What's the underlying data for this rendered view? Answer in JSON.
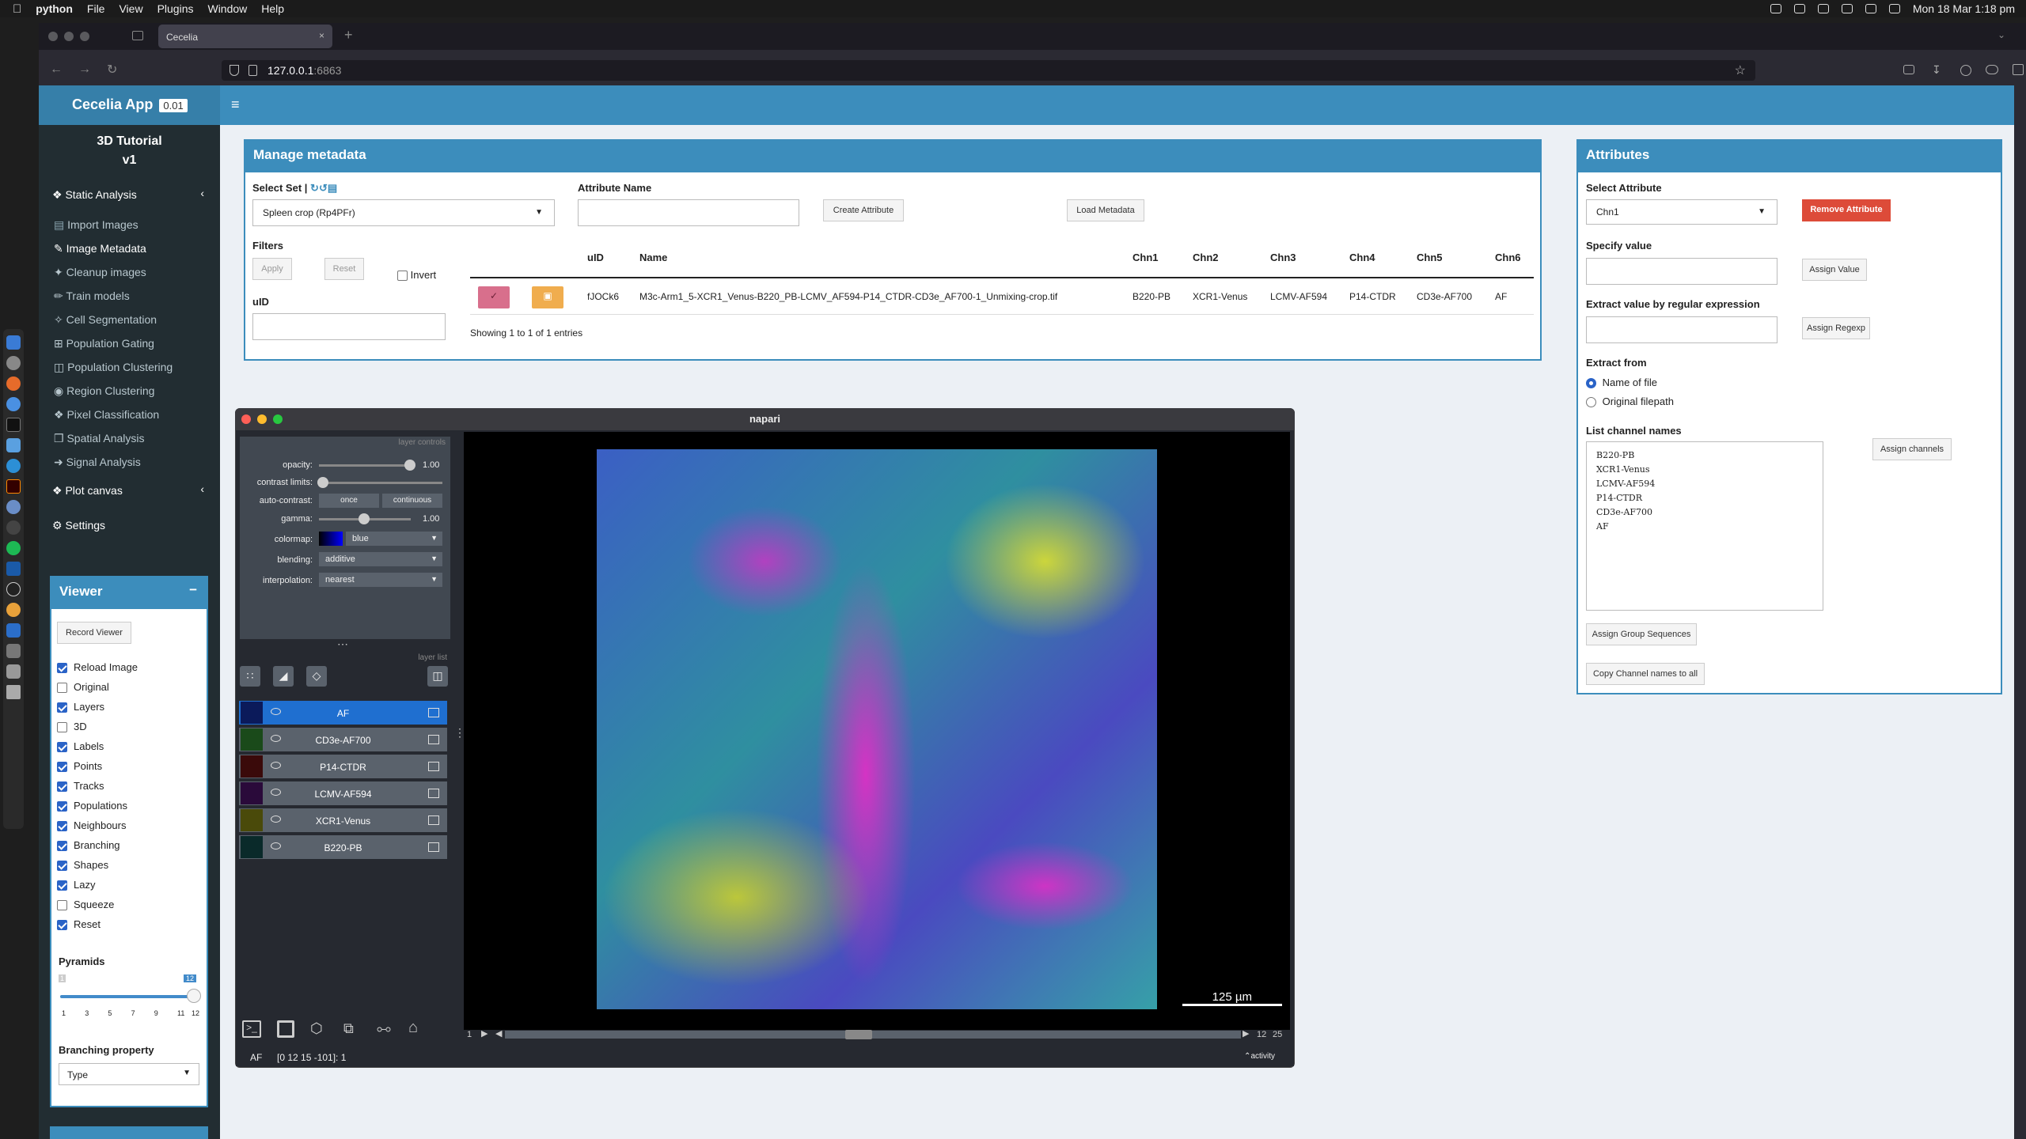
{
  "menubar": {
    "app": "python",
    "items": [
      "File",
      "View",
      "Plugins",
      "Window",
      "Help"
    ],
    "clock": "Mon 18 Mar  1:18 pm"
  },
  "browser": {
    "tab_title": "Cecelia",
    "url_host": "127.0.0.1",
    "url_port": ":6863"
  },
  "app": {
    "brand": "Cecelia App",
    "version": "0.01",
    "project_title": "3D Tutorial",
    "project_version": "v1",
    "sidebar": {
      "static_analysis": "Static Analysis",
      "items": [
        "Import Images",
        "Image Metadata",
        "Cleanup images",
        "Train models",
        "Cell Segmentation",
        "Population Gating",
        "Population Clustering",
        "Region Clustering",
        "Pixel Classification",
        "Spatial Analysis",
        "Signal Analysis"
      ],
      "plot_canvas": "Plot canvas",
      "settings": "Settings"
    },
    "viewer": {
      "title": "Viewer",
      "collapse": "−",
      "record_button": "Record Viewer",
      "options": [
        {
          "label": "Reload Image",
          "checked": true
        },
        {
          "label": "Original",
          "checked": false
        },
        {
          "label": "Layers",
          "checked": true
        },
        {
          "label": "3D",
          "checked": false
        },
        {
          "label": "Labels",
          "checked": true
        },
        {
          "label": "Points",
          "checked": true
        },
        {
          "label": "Tracks",
          "checked": true
        },
        {
          "label": "Populations",
          "checked": true
        },
        {
          "label": "Neighbours",
          "checked": true
        },
        {
          "label": "Branching",
          "checked": true
        },
        {
          "label": "Shapes",
          "checked": true
        },
        {
          "label": "Lazy",
          "checked": true
        },
        {
          "label": "Squeeze",
          "checked": false
        },
        {
          "label": "Reset",
          "checked": true
        }
      ],
      "pyramids_label": "Pyramids",
      "pyramids_min": "1",
      "pyramids_value": "12",
      "pyramids_level": 1.0,
      "pyramids_ticks": [
        "1",
        "3",
        "5",
        "7",
        "9",
        "11",
        "12"
      ],
      "branching_label": "Branching property",
      "branching_value": "Type"
    },
    "metadata": {
      "title": "Manage metadata",
      "select_set_label": "Select Set |",
      "select_set_value": "Spleen crop (Rp4PFr)",
      "attribute_name_label": "Attribute Name",
      "create_button": "Create Attribute",
      "load_button": "Load Metadata",
      "filters_label": "Filters",
      "apply_button": "Apply",
      "reset_button": "Reset",
      "invert_label": "Invert",
      "uid_label": "uID",
      "columns": [
        "uID",
        "Name",
        "Chn1",
        "Chn2",
        "Chn3",
        "Chn4",
        "Chn5",
        "Chn6"
      ],
      "rows": [
        {
          "uid": "fJOCk6",
          "name": "M3c-Arm1_5-XCR1_Venus-B220_PB-LCMV_AF594-P14_CTDR-CD3e_AF700-1_Unmixing-crop.tif",
          "chn": [
            "B220-PB",
            "XCR1-Venus",
            "LCMV-AF594",
            "P14-CTDR",
            "CD3e-AF700",
            "AF"
          ]
        }
      ],
      "entries_info": "Showing 1 to 1 of 1 entries"
    },
    "attributes": {
      "title": "Attributes",
      "select_label": "Select Attribute",
      "select_value": "Chn1",
      "remove_button": "Remove Attribute",
      "specify_label": "Specify value",
      "assign_value_button": "Assign Value",
      "regex_label": "Extract value by regular expression",
      "assign_regex_button": "Assign Regexp",
      "extract_from_label": "Extract from",
      "extract_options": [
        {
          "label": "Name of file",
          "selected": true
        },
        {
          "label": "Original filepath",
          "selected": false
        }
      ],
      "channel_names_label": "List channel names",
      "channel_names": [
        "B220-PB",
        "XCR1-Venus",
        "LCMV-AF594",
        "P14-CTDR",
        "CD3e-AF700",
        "AF"
      ],
      "assign_channels_button": "Assign channels",
      "group_seq_button": "Assign Group Sequences",
      "copy_channels_button": "Copy Channel names to all"
    }
  },
  "napari": {
    "title": "napari",
    "layer_controls_label": "layer controls",
    "layer_list_label": "layer list",
    "controls": {
      "opacity_label": "opacity:",
      "opacity_value": "1.00",
      "contrast_label": "contrast limits:",
      "auto_contrast_label": "auto-contrast:",
      "once": "once",
      "continuous": "continuous",
      "gamma_label": "gamma:",
      "gamma_value": "1.00",
      "colormap_label": "colormap:",
      "colormap_value": "blue",
      "blending_label": "blending:",
      "blending_value": "additive",
      "interpolation_label": "interpolation:",
      "interpolation_value": "nearest"
    },
    "layers": [
      "AF",
      "CD3e-AF700",
      "P14-CTDR",
      "LCMV-AF594",
      "XCR1-Venus",
      "B220-PB"
    ],
    "selected_layer": "AF",
    "scale_bar": "125 µm",
    "slider_start": "1",
    "slider_value": "12",
    "slider_max": "25",
    "status_layer": "AF",
    "status_coords": "[0 12 15 -101]: 1",
    "activity": "activity",
    "colors": {
      "selected_layer": "#1f6fd0",
      "accent": "#3c8dbc",
      "remove": "#dd4b39"
    }
  }
}
